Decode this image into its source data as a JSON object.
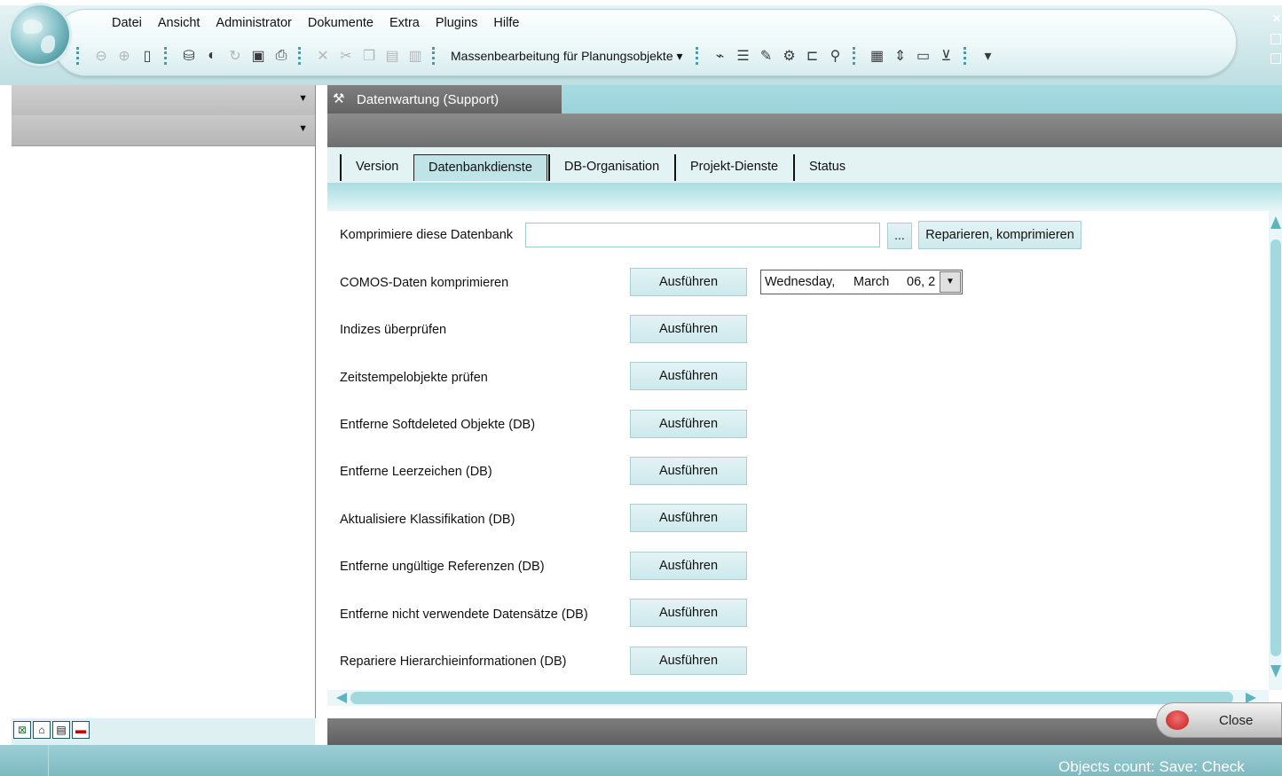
{
  "menu": [
    "Datei",
    "Ansicht",
    "Administrator",
    "Dokumente",
    "Extra",
    "Plugins",
    "Hilfe"
  ],
  "toolbar": {
    "mass_edit_label": "Massenbearbeitung für Planungsobjekte ▾"
  },
  "document_tab": {
    "title": "Datenwartung (Support)"
  },
  "subtabs": [
    "Version",
    "Datenbankdienste",
    "DB-Organisation",
    "Projekt-Dienste",
    "Status"
  ],
  "compress_db": {
    "label": "Komprimiere diese Datenbank",
    "value": "",
    "browse_label": "...",
    "repair_label": "Reparieren, komprimieren"
  },
  "date_picker": {
    "weekday": "Wednesday,",
    "month": "March",
    "day": "06, 2"
  },
  "run_label": "Ausführen",
  "services": [
    "COMOS-Daten komprimieren",
    "Indizes überprüfen",
    "Zeitstempelobjekte prüfen",
    "Entferne Softdeleted Objekte (DB)",
    "Entferne Leerzeichen (DB)",
    "Aktualisiere Klassifikation (DB)",
    "Entferne ungültige Referenzen (DB)",
    "Entferne nicht verwendete Datensätze (DB)",
    "Repariere Hierarchieinformationen (DB)"
  ],
  "close_label": "Close",
  "status_text": "Objects count:  Save:  Check"
}
